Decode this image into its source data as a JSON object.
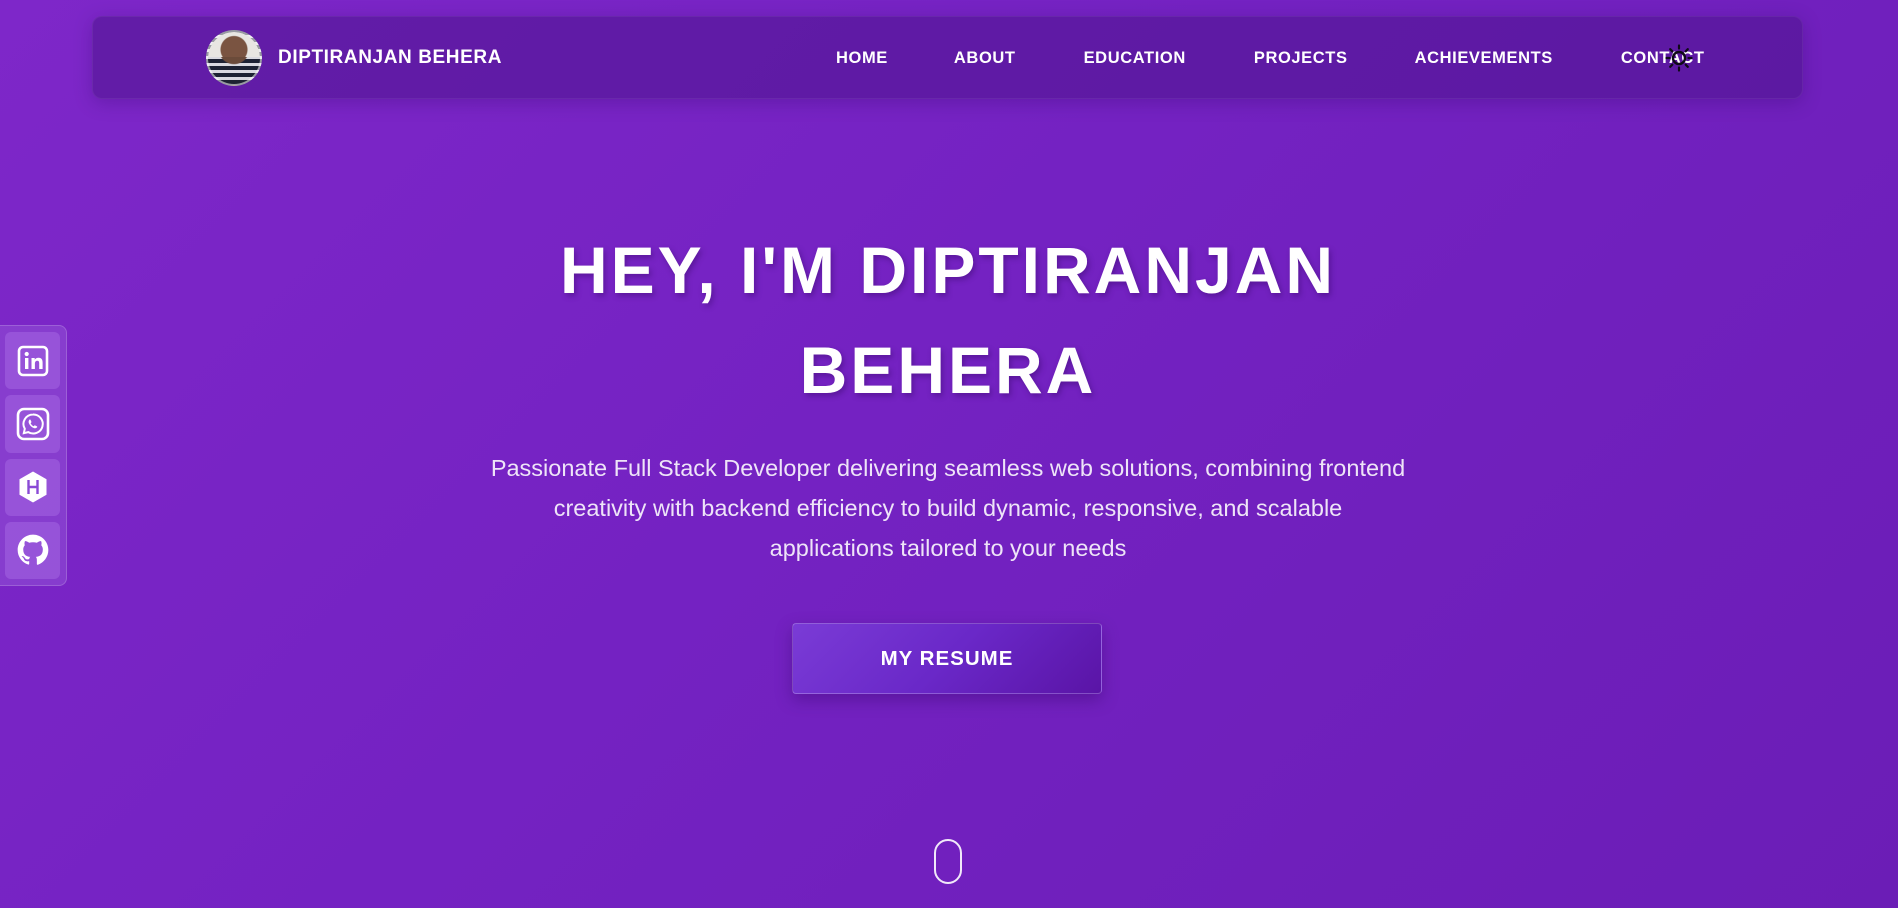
{
  "brand": {
    "name": "DIPTIRANJAN BEHERA",
    "avatar_icon": "profile-photo"
  },
  "nav": {
    "links": [
      {
        "label": "HOME"
      },
      {
        "label": "ABOUT"
      },
      {
        "label": "EDUCATION"
      },
      {
        "label": "PROJECTS"
      },
      {
        "label": "ACHIEVEMENTS"
      },
      {
        "label": "CONTACT"
      }
    ],
    "theme_toggle_icon": "sun-icon"
  },
  "social": [
    {
      "icon": "linkedin-icon"
    },
    {
      "icon": "whatsapp-icon"
    },
    {
      "icon": "hackerrank-icon"
    },
    {
      "icon": "github-icon"
    }
  ],
  "hero": {
    "title_line1": "HEY, I'M DIPTIRANJAN",
    "title_line2": "BEHERA",
    "subtitle_line1": "Passionate Full Stack Developer delivering seamless web solutions, combining frontend",
    "subtitle_line2": "creativity with backend efficiency to build dynamic, responsive, and scalable",
    "subtitle_line3": "applications tailored to your needs",
    "button_label": "MY RESUME"
  },
  "colors": {
    "background": "#7422c2",
    "navbar": "#5a1c9c",
    "button": "#6a28c8",
    "text": "#ffffff"
  }
}
